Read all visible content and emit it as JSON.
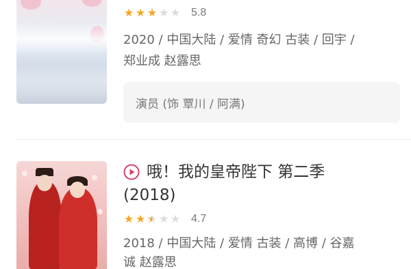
{
  "colors": {
    "accent_play": "#d9416a",
    "star_full": "#f5a623",
    "star_empty": "#dcdcdc",
    "actor_box_bg": "#f5f5f5"
  },
  "results": [
    {
      "rating": {
        "stars": 3,
        "max_stars": 5,
        "score": "5.8"
      },
      "meta_line1": "2020 / 中国大陆 / 爱情 奇幻 古装 / 回宇 /",
      "meta_line2": "郑业成 赵露思",
      "actor_role": "演员 (饰 覃川 / 阿满)"
    },
    {
      "play_icon": "play-circle-icon",
      "title": "哦！我的皇帝陛下 第二季",
      "year": "(2018)",
      "rating": {
        "stars": 2.5,
        "max_stars": 5,
        "score": "4.7"
      },
      "meta_line1": "2018 / 中国大陆 / 爱情 古装 / 高博 / 谷嘉",
      "meta_line2": "诚 赵露思"
    }
  ]
}
